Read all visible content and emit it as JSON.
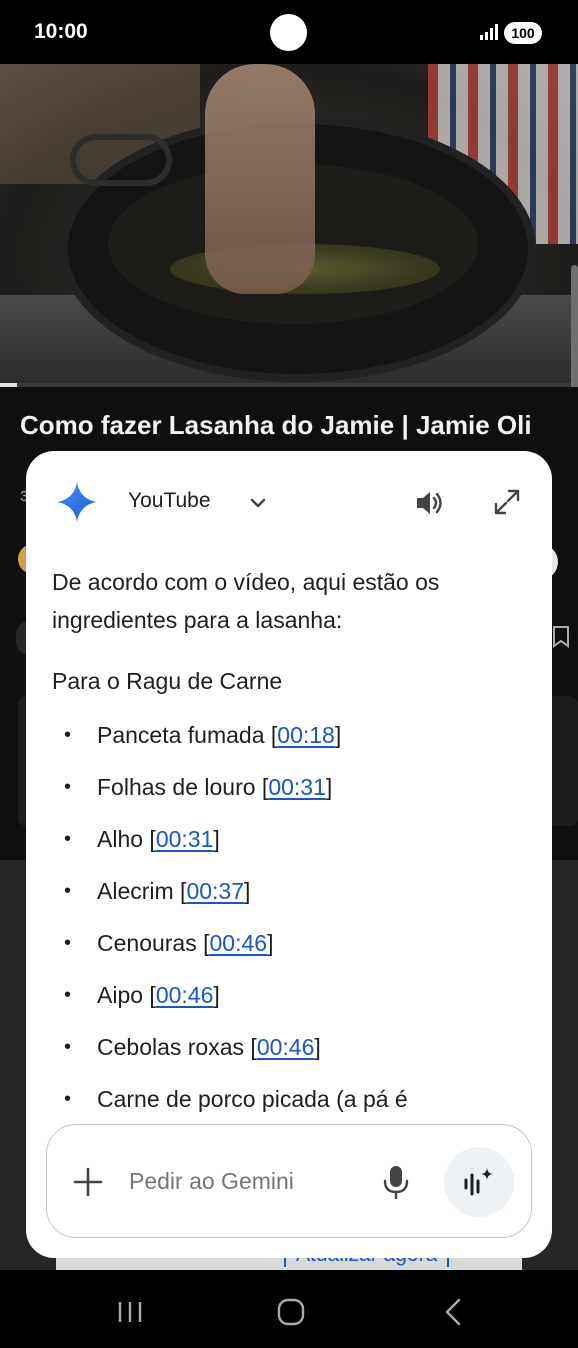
{
  "status_bar": {
    "time": "10:00",
    "battery": "100"
  },
  "background_app": {
    "video_title": "Como fazer Lasanha do Jamie | Jamie Oli",
    "video_progress": 0.03,
    "subtitle": "3",
    "banner_text": "Atualizar agora"
  },
  "gemini": {
    "source_label": "YouTube",
    "intro": "De acordo com o vídeo, aqui estão os ingredientes para a lasanha:",
    "section_title": "Para o Ragu de Carne",
    "ingredients": [
      {
        "name": "Panceta fumada",
        "time": "00:18"
      },
      {
        "name": "Folhas de louro",
        "time": "00:31"
      },
      {
        "name": "Alho",
        "time": "00:31"
      },
      {
        "name": "Alecrim",
        "time": "00:37"
      },
      {
        "name": "Cenouras",
        "time": "00:46"
      },
      {
        "name": "Aipo",
        "time": "00:46"
      },
      {
        "name": "Cebolas roxas",
        "time": "00:46"
      },
      {
        "name": "Carne de porco picada (a pá é",
        "time": ""
      }
    ],
    "input_placeholder": "Pedir ao Gemini",
    "icons": [
      "gemini-star-icon",
      "chevron-down-icon",
      "speaker-icon",
      "expand-icon",
      "plus-icon",
      "mic-icon",
      "live-icon"
    ],
    "link_color": "#1a56c4"
  },
  "nav_bar": {
    "icons": [
      "recent-apps-icon",
      "home-icon",
      "back-icon"
    ]
  }
}
